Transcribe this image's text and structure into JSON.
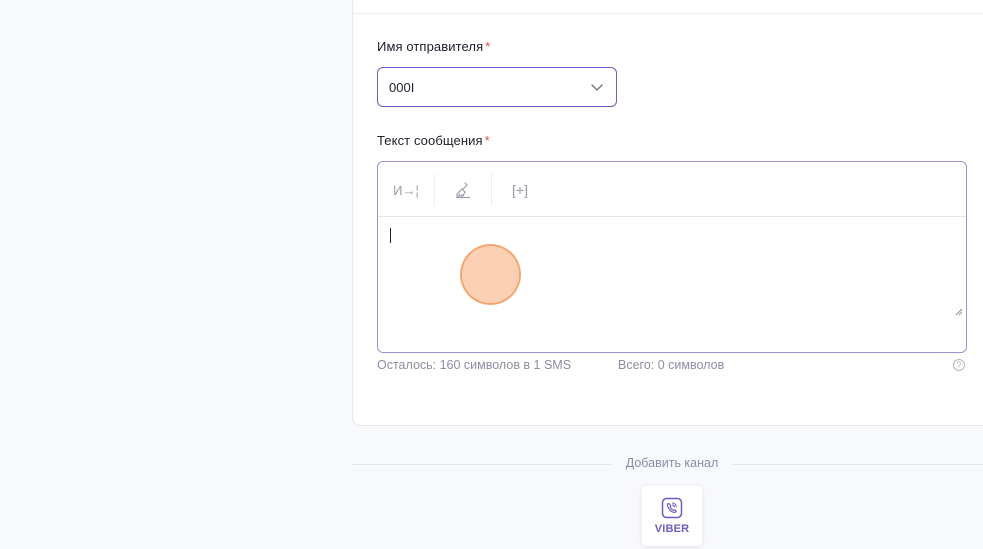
{
  "sender": {
    "label": "Имя отправителя",
    "required_mark": "*",
    "value": "000I"
  },
  "message": {
    "label": "Текст сообщения",
    "required_mark": "*",
    "toolbar": {
      "insert_variable": "И→¦",
      "clear": "clear-brush-icon",
      "insert_field": "[+]"
    },
    "text": ""
  },
  "counter": {
    "remaining": "Осталось: 160 символов в 1 SMS",
    "total": "Всего: 0 символов",
    "help": "?"
  },
  "add_channel": {
    "label": "Добавить канал",
    "channels": [
      {
        "label": "VIBER",
        "icon": "viber-icon",
        "color": "#6a5fc1"
      }
    ]
  },
  "colors": {
    "accent": "#6a5fc1",
    "required": "#e5484d"
  }
}
